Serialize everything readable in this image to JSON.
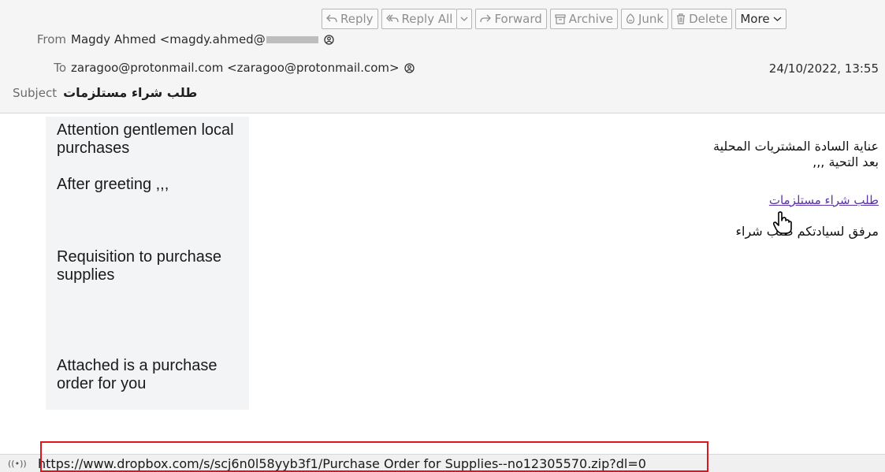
{
  "toolbar": {
    "reply": "Reply",
    "reply_all": "Reply All",
    "forward": "Forward",
    "archive": "Archive",
    "junk": "Junk",
    "delete": "Delete",
    "more": "More"
  },
  "header": {
    "from_label": "From",
    "from_value": "Magdy Ahmed <magdy.ahmed@",
    "to_label": "To",
    "to_value": "zaragoo@protonmail.com <zaragoo@protonmail.com>",
    "subject_label": "Subject",
    "subject_value": "طلب شراء مستلزمات",
    "date": "24/10/2022, 13:55"
  },
  "body": {
    "left": {
      "p1": "Attention gentlemen local purchases",
      "p2": "After greeting ,,,",
      "p3": "Requisition to purchase supplies",
      "p4": "Attached is a purchase order for you"
    },
    "right": {
      "line1": "عناية السادة المشتريات المحلية",
      "line2": "بعد التحية ,,,",
      "link": "طلب شراء مستلزمات",
      "line3": "مرفق لسيادتكم طلب شراء"
    }
  },
  "status": {
    "icon": "((•))",
    "url": "https://www.dropbox.com/s/scj6n0l58yyb3f1/Purchase Order for Supplies--no12305570.zip?dl=0"
  },
  "colors": {
    "highlight": "#e0141a",
    "link": "#5b33a8"
  }
}
